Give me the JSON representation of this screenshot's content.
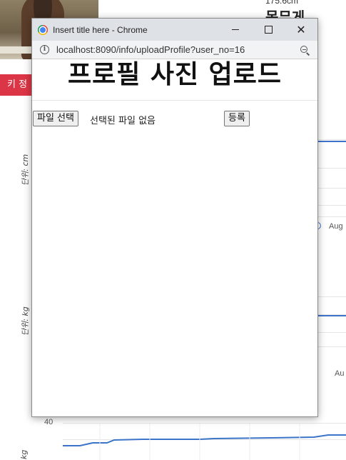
{
  "background": {
    "height_text": "175.6cm",
    "heading": "몸무게",
    "red_button": "키 정",
    "chart1_ylabel": "단위: cm",
    "chart2_ylabel": "단위: kg",
    "chart3_ylabel": "kg",
    "chart1_xtick": "Aug",
    "chart2_xtick": "Au",
    "chart3_ytick": "40",
    "line_color": "#3b74c9"
  },
  "window": {
    "title": "Insert title here - Chrome",
    "url": "localhost:8090/info/uploadProfile?user_no=16",
    "controls": {
      "minimize": "minimize",
      "maximize": "maximize",
      "close": "✕"
    }
  },
  "page": {
    "title": "프로필 사진 업로드",
    "file_button": "파일 선택",
    "file_status": "선택된 파일 없음",
    "submit_button": "등록"
  },
  "colors": {
    "accent_red": "#dc3545",
    "titlebar": "#dee1e6"
  }
}
